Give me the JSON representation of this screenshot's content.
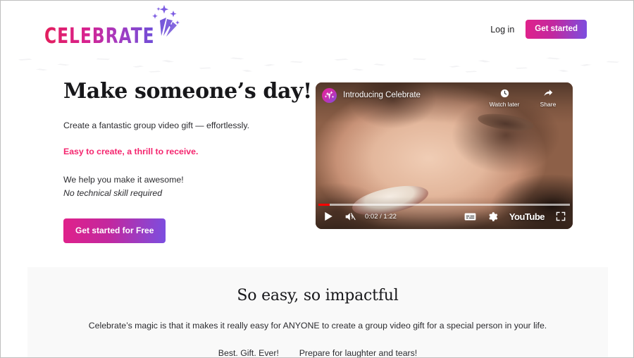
{
  "brand": {
    "logo_text": "CELEBRATE",
    "logo_icon": "firework-sparkle-icon",
    "gradient_start": "#e31e5c",
    "gradient_end": "#6f4fd8"
  },
  "header": {
    "login_label": "Log in",
    "cta_label": "Get started"
  },
  "hero": {
    "title": "Make someone’s day!",
    "subtitle": "Create a fantastic group video gift — effortlessly.",
    "accent_line": "Easy to create, a thrill to receive.",
    "accent_color": "#f4256e",
    "help_line": "We help you make it awesome!",
    "italic_line": "No technical skill required",
    "cta_label": "Get started for Free"
  },
  "video": {
    "title": "Introducing Celebrate",
    "watch_later_label": "Watch later",
    "share_label": "Share",
    "current_time": "0:02",
    "duration": "1:22",
    "time_display": "0:02 / 1:22",
    "progress_percent": 4.5,
    "progress_color": "#ff0000",
    "provider_wordmark": "YouTube",
    "muted": true
  },
  "section": {
    "title": "So easy, so impactful",
    "body": "Celebrate’s magic is that it makes it really easy for ANYONE to create a group video gift for a special person in your life.",
    "tagline_left": "Best. Gift. Ever!",
    "tagline_right": "Prepare for laughter and tears!",
    "background_color": "#f9f9f9"
  }
}
